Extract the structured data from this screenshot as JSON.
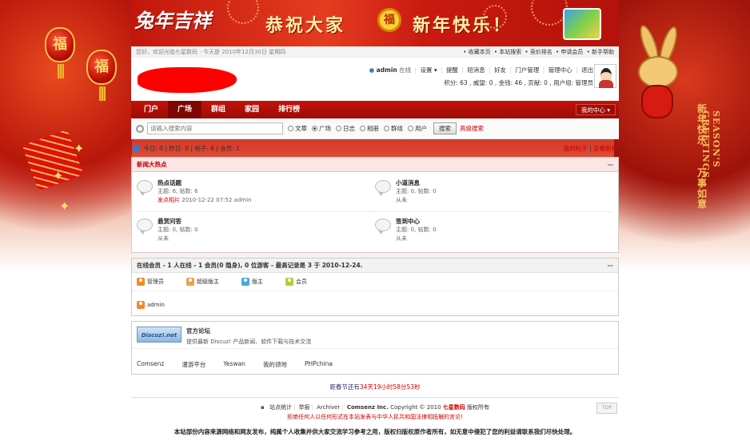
{
  "banner": {
    "logo_text": "兔年吉祥",
    "title_left": "恭祝大家",
    "coin_char": "福",
    "title_right": "新年快乐！"
  },
  "decor": {
    "lantern_char": "福",
    "greeting_cn_top": "新年快乐",
    "greeting_en": "SEASON'S GREETINGS",
    "greeting_cn_bottom": "万事如意"
  },
  "topbar": {
    "welcome": "您好，欢迎光临七星数码",
    "date": "今天是 2010年12月30日 星期四",
    "links": [
      "收藏本页",
      "本站搜索",
      "竞价排名",
      "申请会员",
      "新手帮助"
    ]
  },
  "user": {
    "name": "admin",
    "status": "在线",
    "menu": [
      "设置",
      "提醒",
      "短消息",
      "好友",
      "门户管理",
      "管理中心",
      "退出"
    ],
    "credits": "积分: 63 , 威望: 0 , 金钱: 46 , 贡献: 0 , 用户组: 管理员"
  },
  "nav": {
    "items": [
      "门户",
      "广场",
      "群组",
      "家园",
      "排行榜"
    ],
    "active_index": 1,
    "mine_label": "我的中心"
  },
  "search": {
    "placeholder": "请输入搜索内容",
    "options": [
      "文章",
      "广场",
      "日志",
      "相册",
      "群组",
      "用户"
    ],
    "selected_index": 1,
    "button": "搜索",
    "advanced": "高级搜索"
  },
  "stats": {
    "today": "今日: 0",
    "yesterday": "昨日: 0",
    "posts": "帖子: 6",
    "members": "会员: 1",
    "my_posts": "我的帖子",
    "new_posts": "查看新帖"
  },
  "category": {
    "title": "新闻大热点",
    "collapse": "—",
    "forums": [
      {
        "name": "热点话题",
        "stats": "主题: 6, 帖数: 6",
        "last_label": "发点相片",
        "last": "2010-12-22 07:52 admin"
      },
      {
        "name": "小道消息",
        "stats": "主题: 0, 帖数: 0",
        "last_label": "",
        "last": "从未"
      },
      {
        "name": "悬赏问答",
        "stats": "主题: 0, 帖数: 0",
        "last_label": "",
        "last": "从未"
      },
      {
        "name": "签到中心",
        "stats": "主题: 0, 帖数: 0",
        "last_label": "",
        "last": "从未"
      }
    ]
  },
  "online": {
    "title": "在线会员 - 1 人在线 - 1 会员(0 隐身), 0 位游客 - 最高记录是 3 于 2010-12-24.",
    "collapse": "—",
    "legend": [
      {
        "label": "管理员",
        "color": "#f08a2a"
      },
      {
        "label": "超级版主",
        "color": "#e8a24a"
      },
      {
        "label": "版主",
        "color": "#4aa6d8"
      },
      {
        "label": "会员",
        "color": "#b8c83a"
      }
    ],
    "users": [
      "admin"
    ]
  },
  "links": {
    "logo_text": "Discuz!.net",
    "title": "官方论坛",
    "desc": "提供最新 Discuz! 产品新闻、软件下载与技术交流",
    "text_links": [
      "Comsenz",
      "漫游平台",
      "Yeswan",
      "我的领地",
      "PHPchina"
    ]
  },
  "countdown": {
    "prefix": "距春节还有",
    "days": "34天",
    "hours": "19小时58分53秒"
  },
  "footer": {
    "links": [
      "站点统计",
      "举报",
      "Archiver"
    ],
    "company": "Comsenz Inc.",
    "copyright": "Copyright © 2010",
    "brand": "七星数码",
    "rights": "版权所有",
    "warning": "拒绝任何人以任何形式在本站发表与中华人民共和国法律相抵触的言论!",
    "top_label": "TOP",
    "disclaimer": "本站部份内容来源网络和网友发布，纯属个人收集并供大家交流学习参考之用，版权归版权原作者所有，如无意中侵犯了您的利益请联系我们尽快处理。"
  }
}
